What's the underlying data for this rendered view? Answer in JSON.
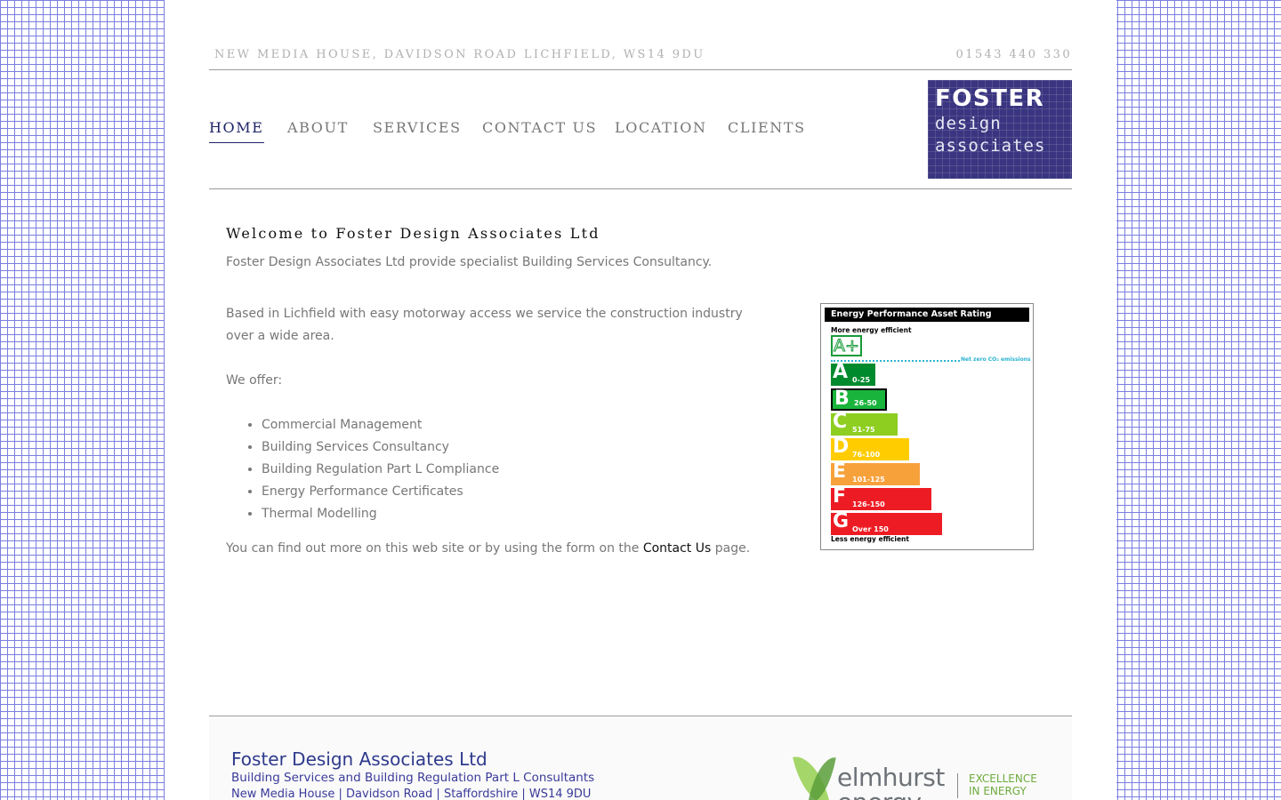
{
  "header": {
    "address": "NEW MEDIA HOUSE, DAVIDSON ROAD  LICHFIELD, WS14 9DU",
    "phone": "01543 440 330"
  },
  "nav": {
    "items": [
      {
        "label": "HOME",
        "active": true
      },
      {
        "label": "ABOUT"
      },
      {
        "label": "SERVICES"
      },
      {
        "label": "CONTACT US"
      },
      {
        "label": "LOCATION"
      },
      {
        "label": "CLIENTS"
      }
    ]
  },
  "logo": {
    "line1": "FOSTER",
    "line2": "design",
    "line3": "associates",
    "color": "#3a3580"
  },
  "content": {
    "heading": "Welcome to Foster Design Associates Ltd",
    "intro": "Foster Design Associates Ltd provide specialist Building Services Consultancy.",
    "para2": "Based in Lichfield with easy motorway access we service the construction industry over a wide area.",
    "offer": "We offer:",
    "services": [
      "Commercial Management",
      "Building Services Consultancy",
      "Building Regulation Part L Compliance",
      "Energy Performance Certificates",
      "Thermal Modelling"
    ],
    "closing_before": "You can find out more on this web site or by using the form on the ",
    "closing_link": "Contact Us",
    "closing_after": " page."
  },
  "epc": {
    "title": "Energy Performance Asset Rating",
    "more_label": "More energy efficient",
    "aplus": "A+",
    "zero_label": "Net zero CO₂ emissions",
    "less_label": "Less energy efficient",
    "bands": [
      {
        "letter": "A",
        "range": "0-25",
        "color": "#008a2e"
      },
      {
        "letter": "B",
        "range": "26-50",
        "color": "#19b43c"
      },
      {
        "letter": "C",
        "range": "51-75",
        "color": "#8dce20"
      },
      {
        "letter": "D",
        "range": "76-100",
        "color": "#ffcc00"
      },
      {
        "letter": "E",
        "range": "101-125",
        "color": "#f7a13a"
      },
      {
        "letter": "F",
        "range": "126-150",
        "color": "#ed1c24"
      },
      {
        "letter": "G",
        "range": "Over 150",
        "color": "#ed1c24"
      }
    ]
  },
  "footer": {
    "company": "Foster Design Associates Ltd",
    "subtitle": "Building Services and Building Regulation Part L Consultants",
    "address": "New Media House | Davidson Road | Staffordshire | WS14 9DU",
    "partner_word1": "elmhurst",
    "partner_word2": "energy",
    "partner_tag1": "EXCELLENCE",
    "partner_tag2": "IN ENERGY"
  }
}
